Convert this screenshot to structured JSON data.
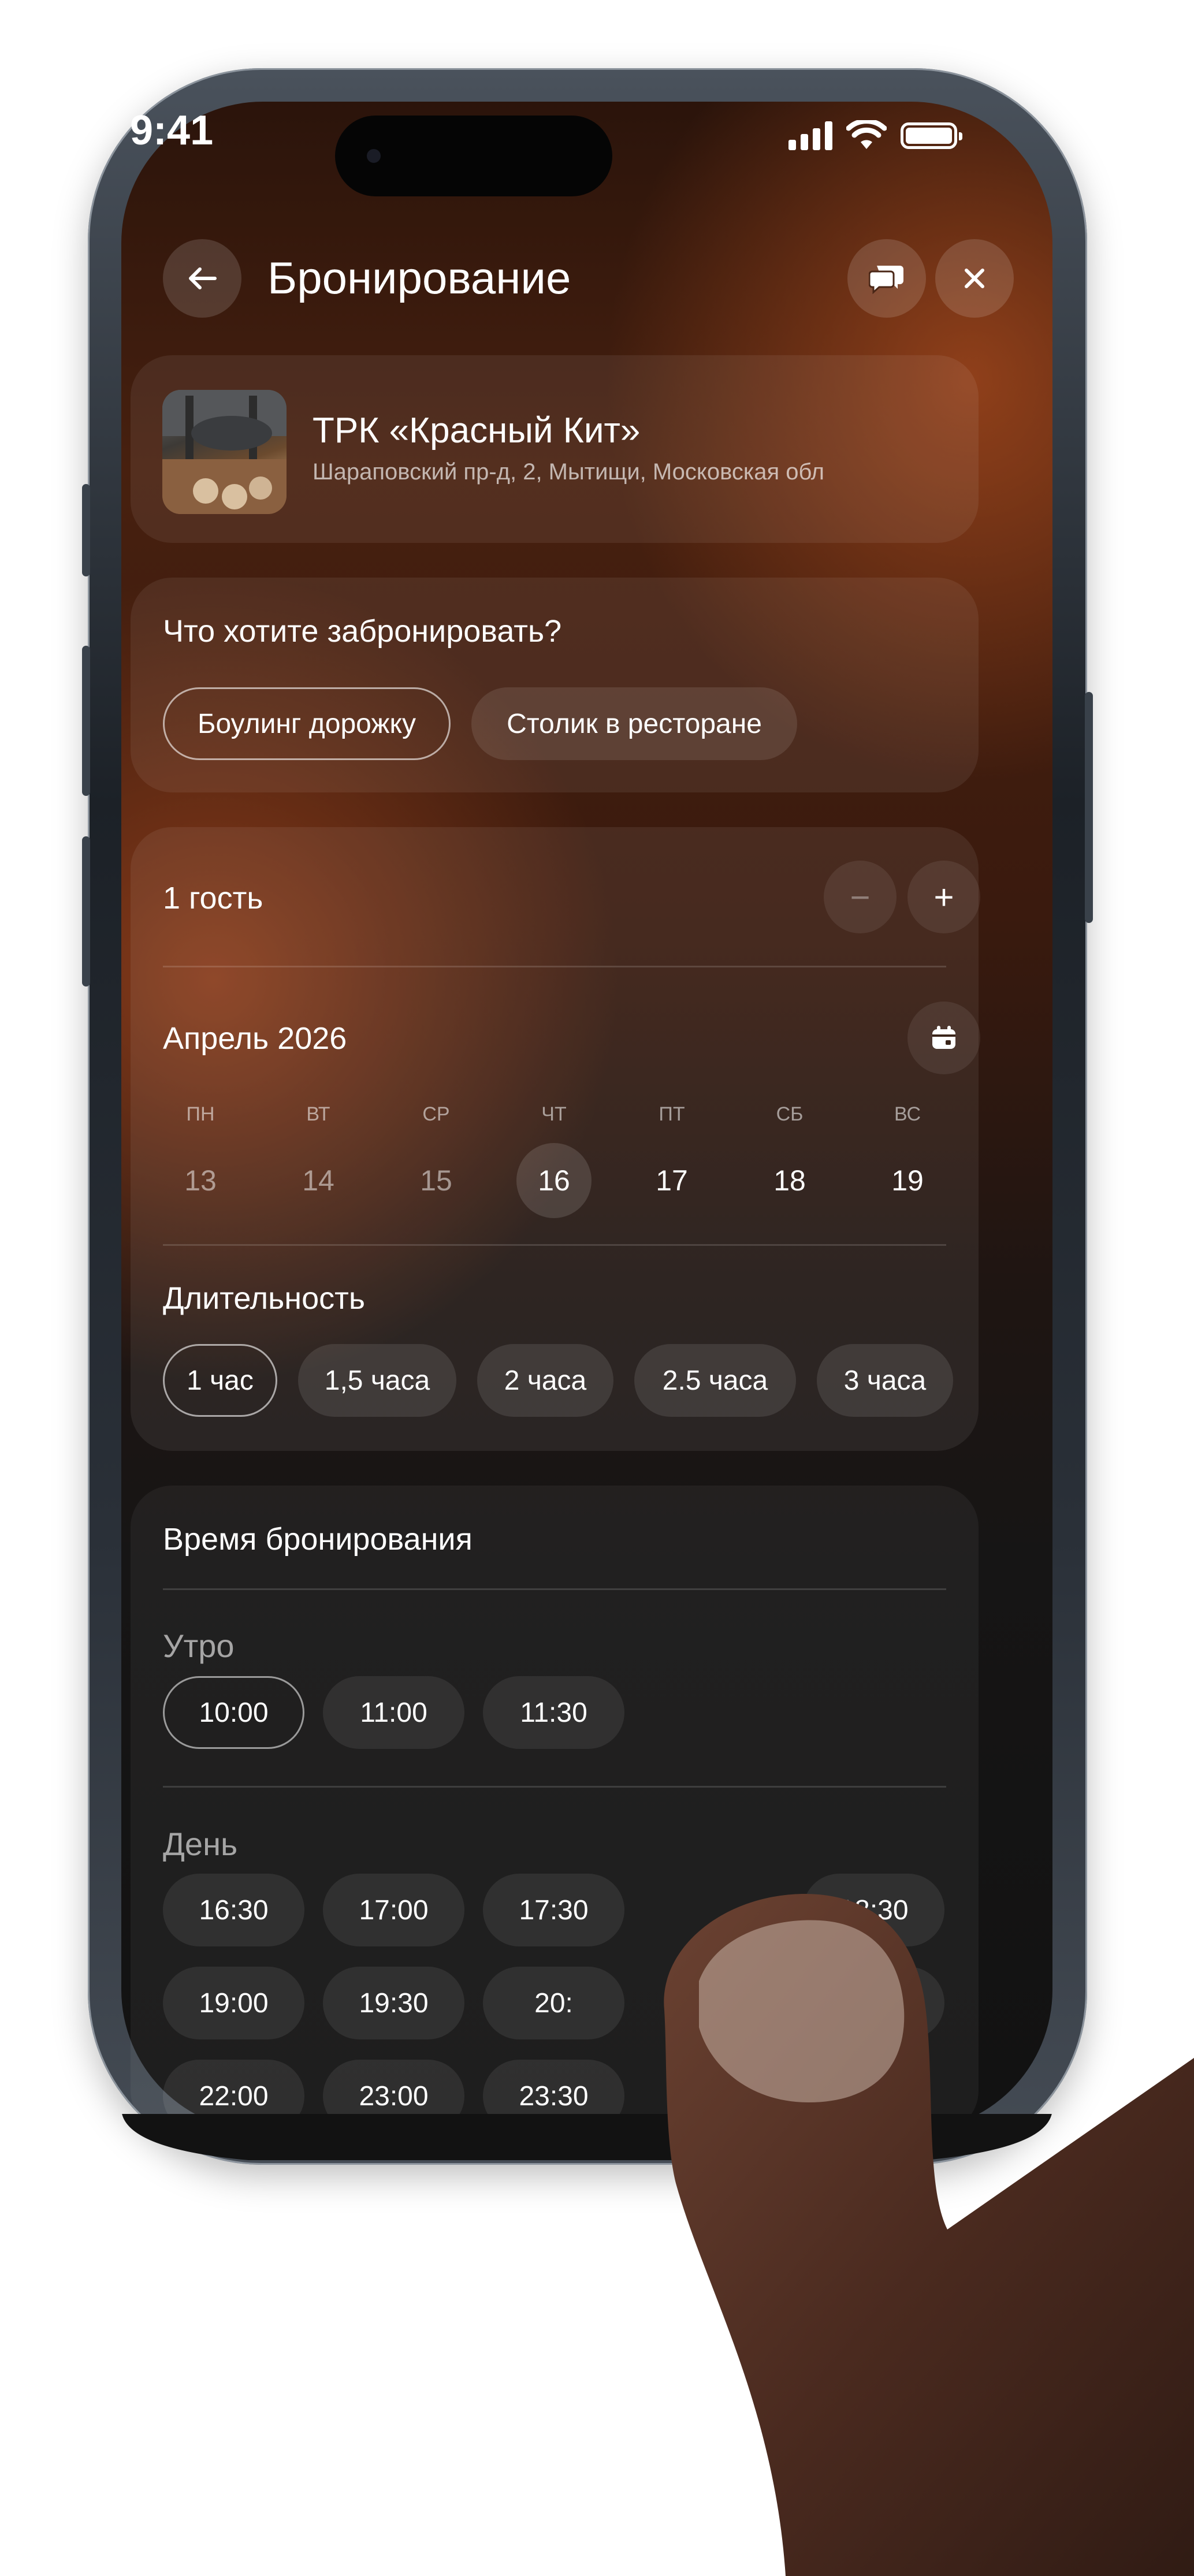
{
  "status_bar": {
    "time": "9:41"
  },
  "header": {
    "title": "Бронирование",
    "back_icon": "arrow-left-icon",
    "chat_icon": "chat-bubbles-icon",
    "close_icon": "close-icon"
  },
  "venue": {
    "name": "ТРК «Красный Кит»",
    "address": "Шараповский пр-д, 2, Мытищи, Московская обл"
  },
  "booking_type": {
    "question": "Что хотите забронировать?",
    "options": [
      "Боулинг дорожку",
      "Столик в ресторане"
    ],
    "selected": "Боулинг дорожку"
  },
  "guests": {
    "label": "1 гость",
    "minus": "−",
    "plus": "+"
  },
  "calendar": {
    "month": "Апрель 2026",
    "days": [
      {
        "dow": "ПН",
        "num": "13"
      },
      {
        "dow": "ВТ",
        "num": "14"
      },
      {
        "dow": "СР",
        "num": "15"
      },
      {
        "dow": "ЧТ",
        "num": "16"
      },
      {
        "dow": "ПТ",
        "num": "17"
      },
      {
        "dow": "СБ",
        "num": "18"
      },
      {
        "dow": "ВС",
        "num": "19"
      }
    ],
    "selected": "16"
  },
  "duration": {
    "label": "Длительность",
    "options": [
      "1 час",
      "1,5 часа",
      "2 часа",
      "2.5 часа",
      "3 часа"
    ],
    "selected": "1 час"
  },
  "booking_time": {
    "label": "Время бронирования",
    "morning": {
      "label": "Утро",
      "slots": [
        "10:00",
        "11:00",
        "11:30"
      ]
    },
    "day": {
      "label": "День",
      "slots": [
        "16:30",
        "17:00",
        "17:30",
        "18:30",
        "19:00",
        "19:30",
        "20:",
        "21:00",
        "22:00",
        "23:00",
        "23:30"
      ]
    },
    "selected": "10:00"
  }
}
